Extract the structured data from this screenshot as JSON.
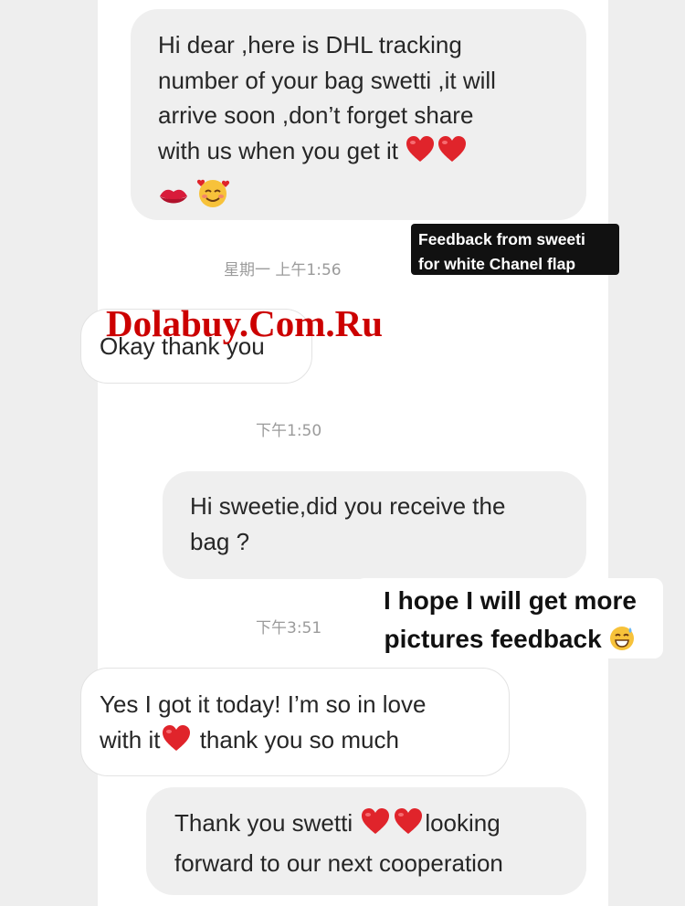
{
  "messages": [
    {
      "id": "m1",
      "direction": "outgoing",
      "text": "Hi dear ,here is DHL tracking\nnumber of your bag swetti ,it will\narrive soon ,don’t forget share\nwith us when you get it"
    },
    {
      "id": "m2",
      "direction": "incoming",
      "text": "Okay thank you"
    },
    {
      "id": "m3",
      "direction": "outgoing",
      "text": "Hi sweetie,did you receive the\nbag ?"
    },
    {
      "id": "m4",
      "direction": "incoming",
      "line1": "Yes I got it today! I’m so in love",
      "line2a": "with it",
      "line2b": " thank you so much"
    },
    {
      "id": "m5",
      "direction": "outgoing",
      "line1a": "Thank you swetti ",
      "line1b": "looking",
      "line2": "forward to our next cooperation"
    }
  ],
  "timestamps": {
    "t1": "星期一 上午1:56",
    "t2": "下午1:50",
    "t3": "下午3:51"
  },
  "stickers": {
    "black": "Feedback from sweeti\nfor white Chanel flap",
    "white_line1": "I hope I will get more",
    "white_line2": "pictures feedback"
  },
  "watermark": "Dolabuy.Com.Ru",
  "icons": [
    "heart-emoji",
    "kiss-lips-emoji",
    "smiling-face-with-hearts-emoji",
    "grinning-sweat-emoji"
  ],
  "colors": {
    "heart": "#e0242b",
    "watermark": "#cc0000",
    "outgoing_bubble": "#efefef",
    "incoming_border": "#e3e3e3"
  }
}
